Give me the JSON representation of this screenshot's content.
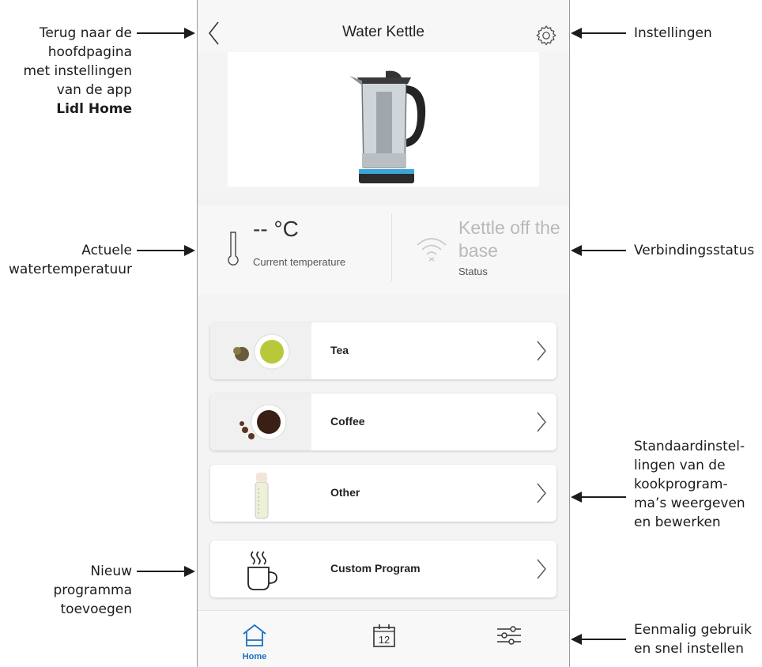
{
  "annotations": {
    "back_lines": [
      "Terug naar de",
      "hoofdpagina",
      "met instellingen",
      "van de app"
    ],
    "back_bold": "Lidl Home",
    "settings": "Instellingen",
    "temperature_lines": [
      "Actuele",
      "watertemperatuur"
    ],
    "connection": "Verbindingsstatus",
    "defaults_lines": [
      "Standaardinstel-",
      "lingen van de",
      "kookprogram-",
      "ma’s weergeven",
      "en bewerken"
    ],
    "new_program_lines": [
      "Nieuw",
      "programma",
      "toevoegen"
    ],
    "quick_lines": [
      "Eenmalig gebruik",
      "en snel instellen"
    ]
  },
  "app": {
    "title": "Water Kettle",
    "temperature_value": "-- °C",
    "temperature_label": "Current temperature",
    "connection_value": "Kettle off the base",
    "connection_label": "Status",
    "programs": [
      "Tea",
      "Coffee",
      "Other",
      "Custom Program"
    ],
    "calendar_day": "12",
    "tab_home_label": "Home"
  },
  "colors": {
    "accent": "#1b6fc2",
    "muted_text": "#b9b9b9"
  },
  "icons": [
    "back-chevron-icon",
    "gear-icon",
    "thermometer-icon",
    "wifi-off-icon",
    "chevron-right-icon",
    "steaming-cup-icon",
    "home-icon",
    "calendar-icon",
    "sliders-icon"
  ]
}
